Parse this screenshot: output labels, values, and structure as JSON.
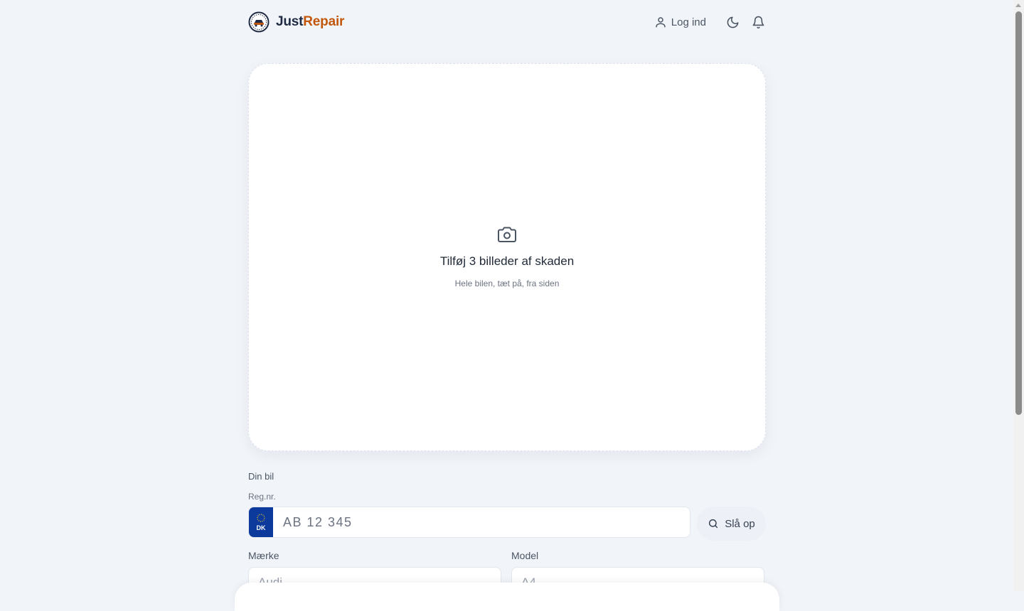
{
  "brand": {
    "name_part1": "Just",
    "name_part2": "Repair"
  },
  "header": {
    "login_label": "Log ind",
    "icons": {
      "user": "user-icon",
      "theme": "moon-icon",
      "notifications": "bell-icon"
    }
  },
  "upload": {
    "icon": "camera-icon",
    "title": "Tilføj 3 billeder af skaden",
    "subtitle": "Hele bilen, tæt på, fra siden"
  },
  "car": {
    "section_label": "Din bil",
    "reg_label": "Reg.nr.",
    "plate_country": "DK",
    "reg_placeholder": "AB 12 345",
    "lookup_label": "Slå op",
    "make_label": "Mærke",
    "make_placeholder": "Audi",
    "model_label": "Model",
    "model_placeholder": "A4"
  },
  "colors": {
    "accent": "#c2570c",
    "brand_dark": "#1f2a44",
    "plate_blue": "#0b3a9c"
  }
}
